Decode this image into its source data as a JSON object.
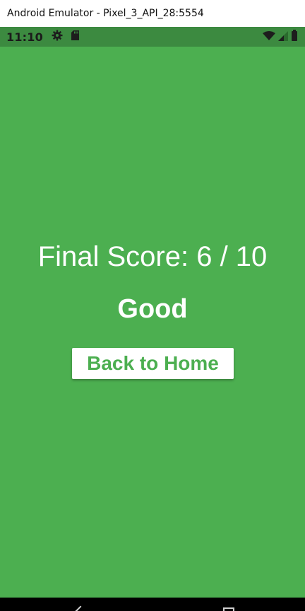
{
  "window": {
    "title": "Android Emulator - Pixel_3_API_28:5554"
  },
  "status_bar": {
    "time": "11:10",
    "left_icons": [
      "settings-gear-icon",
      "sd-card-icon"
    ],
    "right_icons": [
      "wifi-icon",
      "cell-signal-icon",
      "battery-icon"
    ],
    "background": "#3c8a40"
  },
  "screen": {
    "background": "#4caf50",
    "score_text": "Final Score: 6 / 10",
    "rating_text": "Good",
    "home_button_label": "Back to Home"
  },
  "nav_bar": {
    "buttons": [
      "back-icon",
      "recents-icon"
    ]
  }
}
